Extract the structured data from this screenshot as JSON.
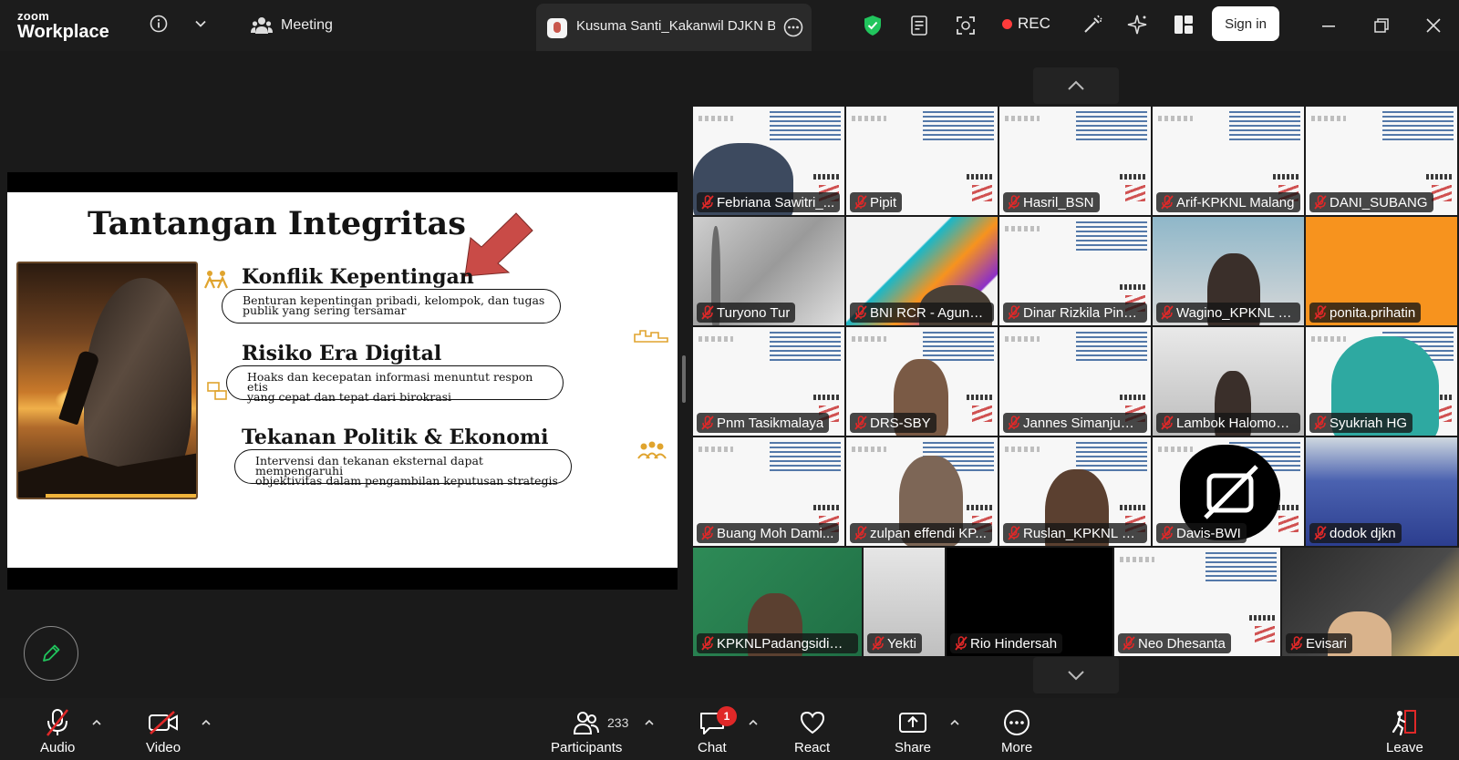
{
  "app": {
    "brand_small": "zoom",
    "brand_large": "Workplace"
  },
  "topbar": {
    "meeting_label": "Meeting",
    "active_speaker": "Kusuma Santi_Kakanwil DJKN Ban",
    "rec_label": "REC",
    "signin_label": "Sign in"
  },
  "slide": {
    "title": "Tantangan Integritas",
    "sections": [
      {
        "heading": "Konflik Kepentingan",
        "body_line1": "Benturan kepentingan pribadi, kelompok, dan tugas",
        "body_line2": "publik yang sering tersamar"
      },
      {
        "heading": "Risiko Era Digital",
        "body_line1": "Hoaks dan kecepatan informasi menuntut respon etis",
        "body_line2": "yang cepat dan tepat dari birokrasi"
      },
      {
        "heading": "Tekanan Politik & Ekonomi",
        "body_line1": "Intervensi dan tekanan eksternal dapat mempengaruhi",
        "body_line2": "objektivitas dalam pengambilan keputusan strategis"
      }
    ]
  },
  "gallery": {
    "participants": [
      "Febriana Sawitri_...",
      "Pipit",
      "Hasril_BSN",
      "Arif-KPKNL Malang",
      "DANI_SUBANG",
      "Turyono Tur",
      "BNI RCR - Agung ...",
      "Dinar Rizkila Pink...",
      "Wagino_KPKNL B...",
      "ponita.prihatin",
      "Pnm Tasikmalaya",
      "DRS-SBY",
      "Jannes Simanjunt...",
      "Lambok Halomoa...",
      "Syukriah HG",
      "Buang Moh Dami...",
      "zulpan effendi KP...",
      "Ruslan_KPKNL Biak",
      "Davis-BWI",
      "dodok djkn",
      "KPKNLPadangsidimp...",
      "Yekti",
      "Rio Hindersah",
      "Neo Dhesanta",
      "Evisari"
    ]
  },
  "toolbar": {
    "audio": "Audio",
    "video": "Video",
    "participants": "Participants",
    "participants_count": "233",
    "chat": "Chat",
    "chat_badge": "1",
    "react": "React",
    "share": "Share",
    "more": "More",
    "leave": "Leave"
  },
  "colors": {
    "accent": "#0b5cff",
    "rec": "#ff3b3b",
    "muted": "#e02828",
    "shield": "#21c55d",
    "orange_tile": "#f7931e"
  }
}
